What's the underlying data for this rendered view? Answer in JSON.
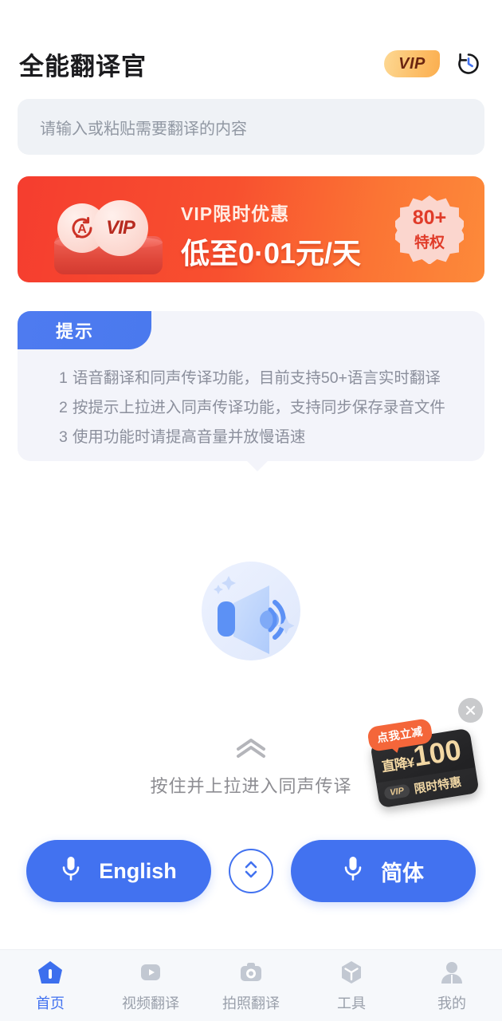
{
  "header": {
    "title": "全能翻译官",
    "vip_label": "VIP",
    "history_icon": "history-clock-icon"
  },
  "input": {
    "placeholder": "请输入或粘贴需要翻译的内容",
    "value": ""
  },
  "vip_banner": {
    "subtitle": "VIP限时优惠",
    "headline": "低至0·01元/天",
    "privilege_count": "80+",
    "privilege_label": "特权",
    "coin_left_icon": "auto-translate-coin-icon",
    "coin_right_label": "VIP",
    "gradient_from": "#F53D2F",
    "gradient_to": "#FD8A3A"
  },
  "tips": {
    "tab_label": "提示",
    "items": [
      {
        "num": "1",
        "text": "语音翻译和同声传译功能，目前支持50+语言实时翻译"
      },
      {
        "num": "2",
        "text": "按提示上拉进入同声传译功能，支持同步保存录音文件"
      },
      {
        "num": "3",
        "text": "使用功能时请提高音量并放慢语速"
      }
    ]
  },
  "illustration": {
    "icon": "speaker-sound-icon"
  },
  "pull_hint": {
    "icon": "double-chevron-up-icon",
    "text": "按住并上拉进入同声传译"
  },
  "promo": {
    "bubble": "点我立减",
    "currency": "直降¥",
    "amount": "100",
    "vip_tag": "VIP",
    "offer_label": "限时特惠",
    "close_icon": "close-icon",
    "bubble_color": "#F4663A",
    "card_color": "#2a2a2c",
    "gold": "#F0D6A1"
  },
  "language_bar": {
    "source": {
      "label": "English",
      "icon": "microphone-icon"
    },
    "target": {
      "label": "简体",
      "icon": "microphone-icon"
    },
    "swap_icon": "swap-vertical-icon",
    "accent": "#4272F0"
  },
  "bottom_nav": {
    "items": [
      {
        "label": "首页",
        "icon": "home-icon",
        "active": true
      },
      {
        "label": "视频翻译",
        "icon": "video-icon",
        "active": false
      },
      {
        "label": "拍照翻译",
        "icon": "camera-icon",
        "active": false
      },
      {
        "label": "工具",
        "icon": "cube-tools-icon",
        "active": false
      },
      {
        "label": "我的",
        "icon": "person-icon",
        "active": false
      }
    ]
  }
}
